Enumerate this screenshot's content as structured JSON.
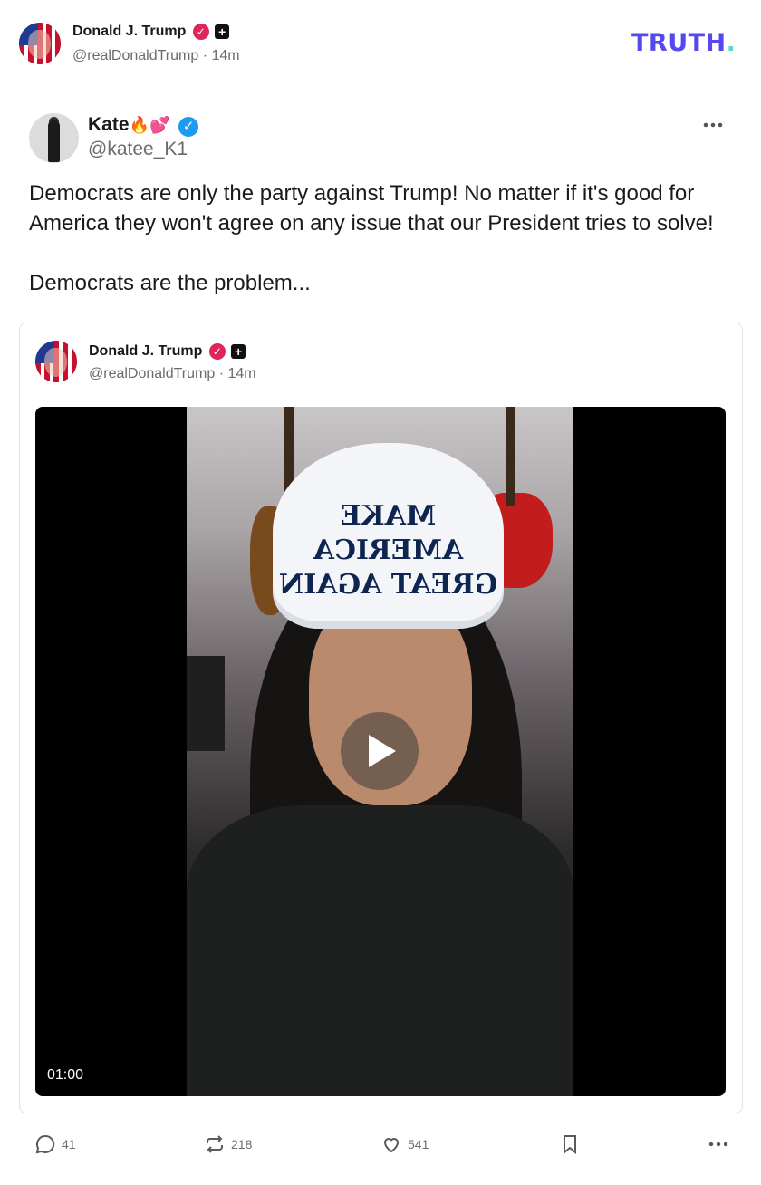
{
  "header": {
    "author_name": "Donald J. Trump",
    "author_handle": "@realDonaldTrump",
    "separator": "·",
    "time": "14m",
    "logo_text": "TRUTH",
    "logo_dot": "."
  },
  "post": {
    "author_name": "Kate",
    "author_emoji": "🔥💕",
    "author_handle": "@katee_K1",
    "more_icon": "more-horizontal-icon",
    "text_line1": "Democrats are only the party against Trump! No matter if it's good for",
    "text_line2": "America they won't agree on any issue that our President tries to solve!",
    "text_line3": "Democrats are the problem..."
  },
  "quote": {
    "author_name": "Donald J. Trump",
    "author_handle": "@realDonaldTrump",
    "separator": "·",
    "time": "14m",
    "video": {
      "duration": "01:00",
      "hat_line1": "MAKE AMERICA",
      "hat_line2": "GREAT AGAIN"
    }
  },
  "actions": {
    "replies": "41",
    "retruths": "218",
    "likes": "541"
  },
  "colors": {
    "logo": "#5448ee",
    "logo_dot": "#5fd7c3",
    "verified": "#e0245e",
    "blue_check": "#1d9bf0"
  }
}
